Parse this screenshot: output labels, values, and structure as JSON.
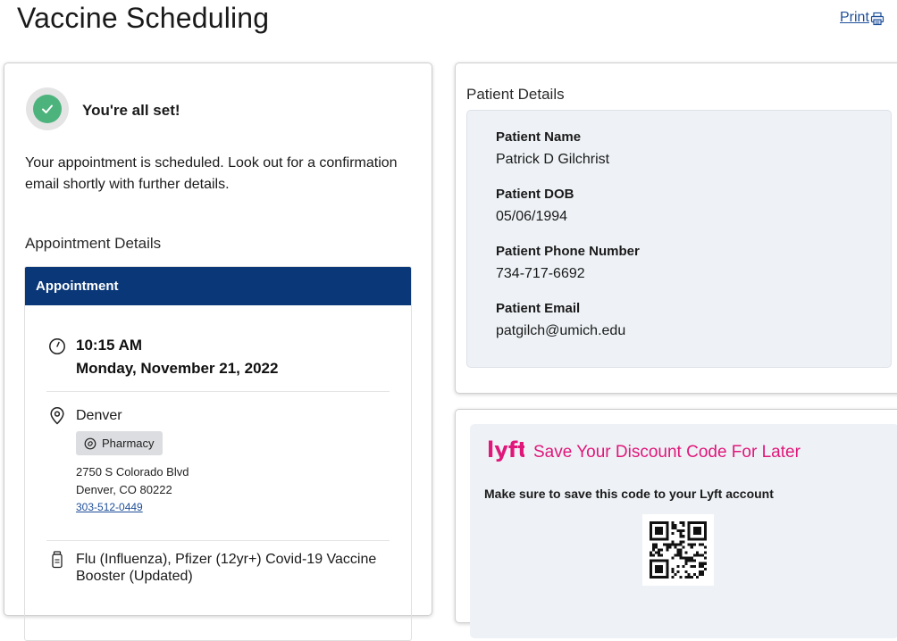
{
  "header": {
    "title": "Vaccine Scheduling",
    "print_label": "Print"
  },
  "confirmation": {
    "heading": "You're all set!",
    "message": "Your appointment is scheduled. Look out for a confirmation email shortly with further details."
  },
  "appointment": {
    "section_label": "Appointment Details",
    "header": "Appointment",
    "time": "10:15 AM",
    "date": "Monday, November 21, 2022",
    "location_name": "Denver",
    "location_type": "Pharmacy",
    "address_line1": "2750 S Colorado Blvd",
    "address_line2": "Denver, CO 80222",
    "phone": "303-512-0449",
    "vaccine": "Flu (Influenza), Pfizer (12yr+) Covid-19 Vaccine Booster (Updated)"
  },
  "patient": {
    "section_label": "Patient Details",
    "fields": [
      {
        "label": "Patient Name",
        "value": "Patrick D Gilchrist"
      },
      {
        "label": "Patient DOB",
        "value": "05/06/1994"
      },
      {
        "label": "Patient Phone Number",
        "value": "734-717-6692"
      },
      {
        "label": "Patient Email",
        "value": "patgilch@umich.edu"
      }
    ]
  },
  "lyft": {
    "logo_text": "lyft",
    "title": "Save Your Discount Code For Later",
    "note": "Make sure to save this code to your Lyft account"
  },
  "colors": {
    "navy_header": "#0a3778",
    "success_green": "#4db37d",
    "link_blue": "#1f4f9a",
    "lyft_pink": "#e0177a",
    "panel_gray": "#eef2f6"
  },
  "icons": {
    "confirm": "check-icon",
    "print": "printer-icon",
    "time": "clock-icon",
    "location": "map-pin-icon",
    "pharmacy": "pharmacy-tag-icon",
    "vaccine": "vaccine-vial-icon",
    "lyft": "lyft-logo",
    "qr": "qr-code"
  }
}
